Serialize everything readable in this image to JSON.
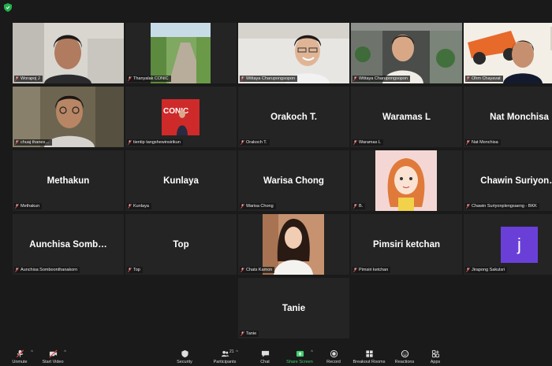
{
  "participants": [
    {
      "label": "Worapoj J",
      "center": "",
      "video": "person1"
    },
    {
      "label": "Thanyalak CONIC",
      "center": "",
      "video": "garden"
    },
    {
      "label": "Wittaya Charupongsopon",
      "center": "",
      "video": "person2"
    },
    {
      "label": "Wittaya Charupongsopon",
      "center": "",
      "video": "person3"
    },
    {
      "label": "Ohm Chayavat",
      "center": "",
      "video": "person4"
    },
    {
      "label": "chuaj thanes…",
      "center": "",
      "video": "person5",
      "active": true
    },
    {
      "label": "tientip tangshewinsirikun",
      "center": "",
      "video": "conic"
    },
    {
      "label": "Orakoch T.",
      "center": "Orakoch T.",
      "video": ""
    },
    {
      "label": "Waramas L",
      "center": "Waramas L",
      "video": ""
    },
    {
      "label": "Nat Monchisa",
      "center": "Nat Monchisa",
      "video": ""
    },
    {
      "label": "Methakun",
      "center": "Methakun",
      "video": ""
    },
    {
      "label": "Kunlaya",
      "center": "Kunlaya",
      "video": ""
    },
    {
      "label": "Warisa Chong",
      "center": "Warisa Chong",
      "video": ""
    },
    {
      "label": "B.",
      "center": "",
      "video": "cartoon"
    },
    {
      "label": "Chawin Suriyonplengsaeng - BKK",
      "center": "Chawin  Suriyon…",
      "video": ""
    },
    {
      "label": "Aunchisa Somboonthanakorn",
      "center": "Aunchisa  Somb…",
      "video": ""
    },
    {
      "label": "Top",
      "center": "Top",
      "video": ""
    },
    {
      "label": "Chats Kamon",
      "center": "",
      "video": "woman"
    },
    {
      "label": "Pimsiri ketchan",
      "center": "Pimsiri ketchan",
      "video": ""
    },
    {
      "label": "Jirapong Sakulsri",
      "center": "",
      "video": "avatar-j",
      "avatar_letter": "j"
    },
    {
      "label": "Tanie",
      "center": "Tanie",
      "video": ""
    }
  ],
  "toolbar": {
    "unmute": "Unmute",
    "start_video": "Start Video",
    "security": "Security",
    "participants": "Participants",
    "participants_count": "21",
    "chat": "Chat",
    "share_screen": "Share Screen",
    "record": "Record",
    "breakout_rooms": "Breakout Rooms",
    "reactions": "Reactions",
    "apps": "Apps"
  },
  "colors": {
    "background": "#1a1a1a",
    "tile": "#242424",
    "active_speaker": "#c8d83b",
    "share_green": "#3ecf6e",
    "mute_red": "#e5484d",
    "avatar_purple": "#6a3fd8"
  }
}
